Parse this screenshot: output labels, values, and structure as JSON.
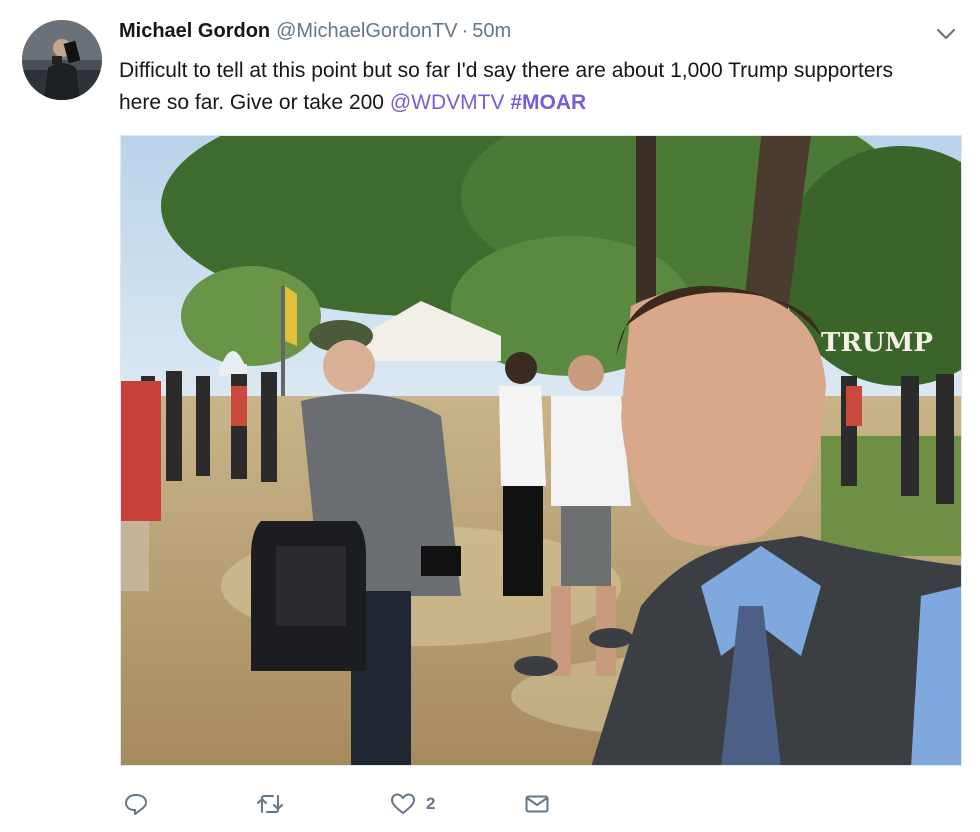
{
  "tweet": {
    "author_name": "Michael Gordon",
    "handle": "@MichaelGordonTV",
    "separator": "·",
    "time": "50m",
    "text_part1": "Difficult to tell at this point but so far I'd say there are about 1,000 Trump supporters here so far. Give or take 200 ",
    "mention": "@WDVMTV",
    "hashtag": "#MOAR"
  },
  "photo": {
    "sign_text": "TRUMP"
  },
  "actions": {
    "reply_icon": "reply-icon",
    "retweet_icon": "retweet-icon",
    "like_icon": "heart-icon",
    "like_count": "2",
    "dm_icon": "envelope-icon"
  },
  "colors": {
    "link": "#7a5bd6",
    "secondary_text": "#657786",
    "icon": "#657786"
  }
}
